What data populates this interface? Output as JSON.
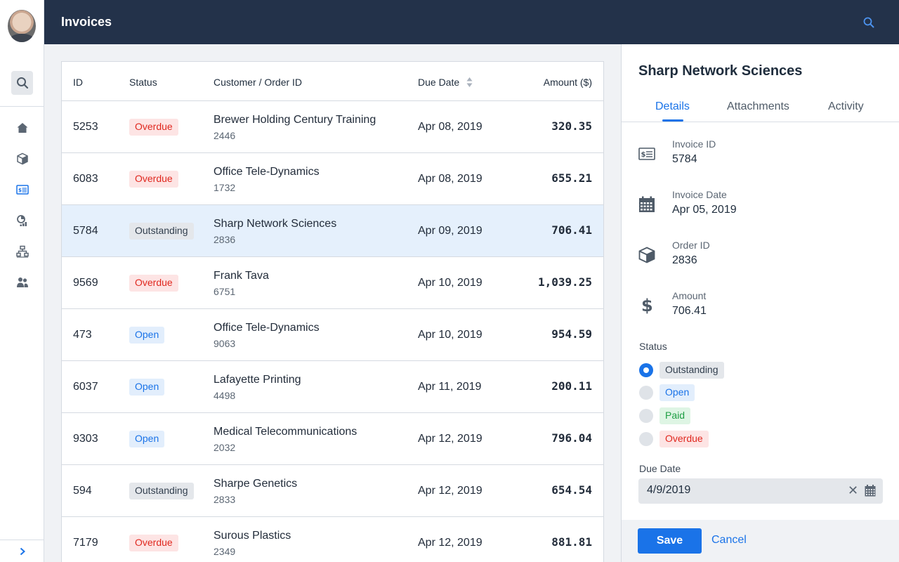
{
  "header": {
    "title": "Invoices"
  },
  "table": {
    "columns": [
      "ID",
      "Status",
      "Customer / Order ID",
      "Due Date",
      "Amount ($)"
    ],
    "rows": [
      {
        "id": "5253",
        "status": "Overdue",
        "status_kind": "overdue",
        "customer": "Brewer Holding Century Training",
        "order": "2446",
        "due": "Apr 08, 2019",
        "amount": "320.35"
      },
      {
        "id": "6083",
        "status": "Overdue",
        "status_kind": "overdue",
        "customer": "Office Tele-Dynamics",
        "order": "1732",
        "due": "Apr 08, 2019",
        "amount": "655.21"
      },
      {
        "id": "5784",
        "status": "Outstanding",
        "status_kind": "outstanding",
        "customer": "Sharp Network Sciences",
        "order": "2836",
        "due": "Apr 09, 2019",
        "amount": "706.41",
        "selected": true
      },
      {
        "id": "9569",
        "status": "Overdue",
        "status_kind": "overdue",
        "customer": "Frank Tava",
        "order": "6751",
        "due": "Apr 10, 2019",
        "amount": "1,039.25"
      },
      {
        "id": "473",
        "status": "Open",
        "status_kind": "open",
        "customer": "Office Tele-Dynamics",
        "order": "9063",
        "due": "Apr 10, 2019",
        "amount": "954.59"
      },
      {
        "id": "6037",
        "status": "Open",
        "status_kind": "open",
        "customer": "Lafayette Printing",
        "order": "4498",
        "due": "Apr 11, 2019",
        "amount": "200.11"
      },
      {
        "id": "9303",
        "status": "Open",
        "status_kind": "open",
        "customer": "Medical Telecommunications",
        "order": "2032",
        "due": "Apr 12, 2019",
        "amount": "796.04"
      },
      {
        "id": "594",
        "status": "Outstanding",
        "status_kind": "outstanding",
        "customer": "Sharpe Genetics",
        "order": "2833",
        "due": "Apr 12, 2019",
        "amount": "654.54"
      },
      {
        "id": "7179",
        "status": "Overdue",
        "status_kind": "overdue",
        "customer": "Surous Plastics",
        "order": "2349",
        "due": "Apr 12, 2019",
        "amount": "881.81"
      }
    ]
  },
  "panel": {
    "title": "Sharp Network Sciences",
    "tabs": [
      "Details",
      "Attachments",
      "Activity"
    ],
    "fields": {
      "invoice_id_label": "Invoice ID",
      "invoice_id": "5784",
      "invoice_date_label": "Invoice Date",
      "invoice_date": "Apr 05, 2019",
      "order_id_label": "Order ID",
      "order_id": "2836",
      "amount_label": "Amount",
      "amount": "706.41"
    },
    "status_label": "Status",
    "status_options": [
      "Outstanding",
      "Open",
      "Paid",
      "Overdue"
    ],
    "status_selected": "Outstanding",
    "due_date_label": "Due Date",
    "due_date": "4/9/2019",
    "clear_glyph": "✕",
    "save_label": "Save",
    "cancel_label": "Cancel"
  },
  "icons": {
    "rail": [
      "search-icon",
      "home-icon",
      "box-icon",
      "invoice-icon",
      "analytics-icon",
      "org-chart-icon",
      "users-icon",
      "chevron-right-icon"
    ],
    "accent": "#1a73e8",
    "header_bg": "#23324a"
  }
}
